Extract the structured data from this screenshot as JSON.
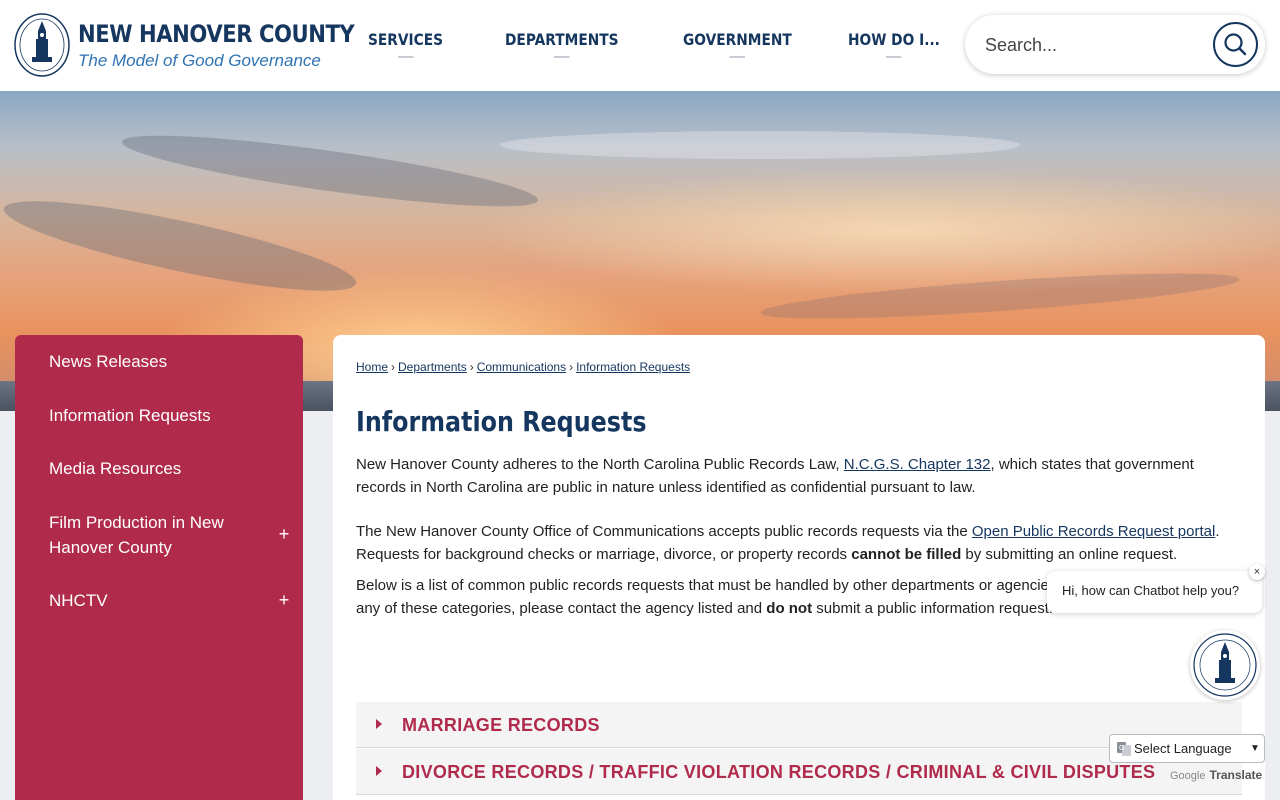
{
  "header": {
    "title": "NEW HANOVER COUNTY",
    "tagline": "The Model of Good Governance",
    "nav": [
      "SERVICES",
      "DEPARTMENTS",
      "GOVERNMENT",
      "HOW DO I..."
    ],
    "search_placeholder": "Search..."
  },
  "sidebar": {
    "items": [
      {
        "label": "News Releases",
        "expandable": false
      },
      {
        "label": "Information Requests",
        "expandable": false
      },
      {
        "label": "Media Resources",
        "expandable": false
      },
      {
        "label": "Film Production in New Hanover County",
        "expandable": true
      },
      {
        "label": "NHCTV",
        "expandable": true
      }
    ],
    "expand_symbol": "+"
  },
  "breadcrumb": [
    "Home",
    "Departments",
    "Communications",
    "Information Requests"
  ],
  "breadcrumb_sep": "›",
  "page": {
    "title": "Information Requests",
    "p1_a": "New Hanover County adheres to the North Carolina Public Records Law, ",
    "p1_link": "N.C.G.S. Chapter 132",
    "p1_b": ", which states that government records in North Carolina are public in nature unless identified as confidential pursuant to law.",
    "p2_a": "The New Hanover County Office of Communications accepts public records requests via the ",
    "p2_link": "Open Public Records Request portal",
    "p2_b": ". Requests for background checks or marriage, divorce, or property records ",
    "p2_bold": "cannot be filled",
    "p2_c": " by submitting an online request.",
    "p3_a": "Below is a list of common public records requests that must be handled by other departments or agencies. If your request falls under any of these categories, please contact the agency listed and ",
    "p3_bold": "do not",
    "p3_b": " submit a public information request.",
    "accordions": [
      "MARRIAGE RECORDS",
      "DIVORCE RECORDS / TRAFFIC VIOLATION RECORDS / CRIMINAL & CIVIL DISPUTES"
    ]
  },
  "chatbot": {
    "greeting": "Hi, how can Chatbot help you?",
    "close": "×"
  },
  "translate": {
    "label": "Select Language",
    "powered_prefix": "Google",
    "powered_suffix": "Translate"
  },
  "colors": {
    "navy": "#15365e",
    "crimson": "#b02a4b",
    "link_blue": "#2e74b5"
  }
}
